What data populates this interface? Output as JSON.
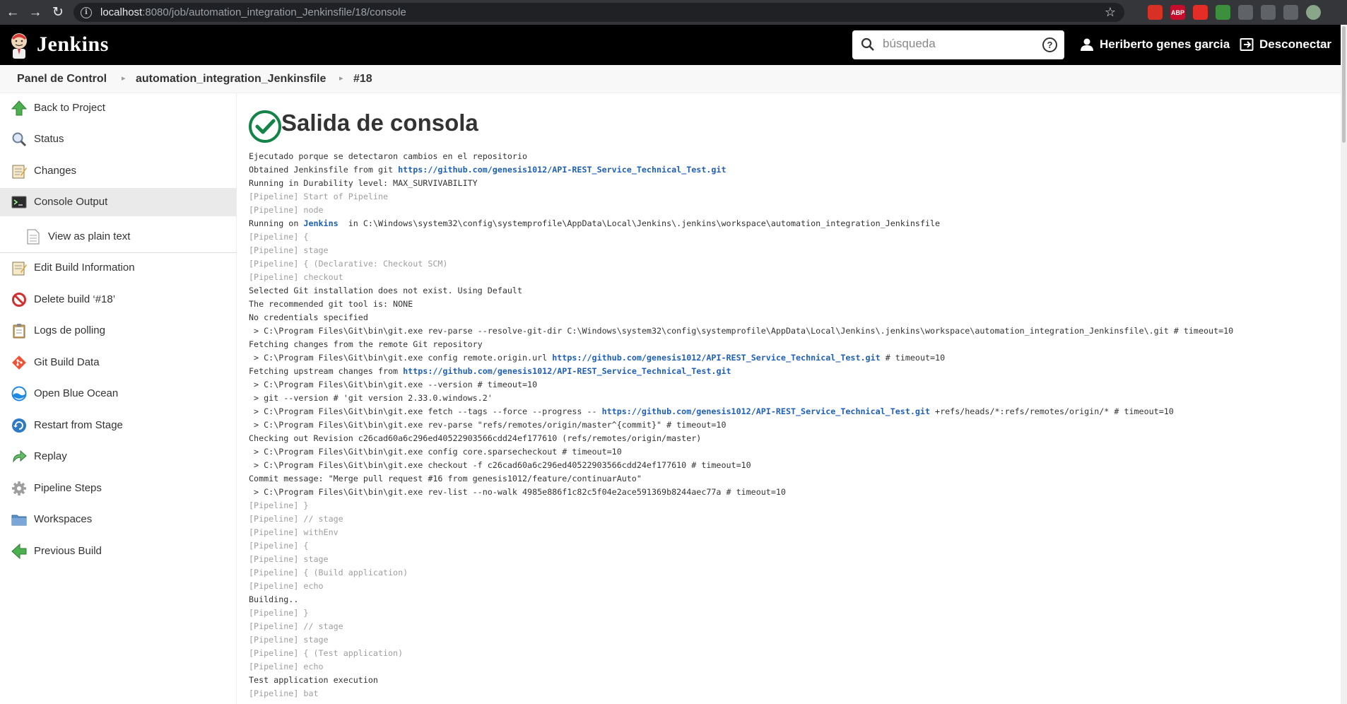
{
  "browser": {
    "url_host": "localhost",
    "url_rest": ":8080/job/automation_integration_Jenkinsfile/18/console",
    "extensions": [
      {
        "name": "ext-red",
        "label": "",
        "color": "#d93025"
      },
      {
        "name": "ext-abp",
        "label": "ABP",
        "color": "#c70d2c"
      },
      {
        "name": "ext-video",
        "label": "",
        "color": "#e52d27"
      },
      {
        "name": "ext-green",
        "label": "",
        "color": "#3c8f3c"
      },
      {
        "name": "ext-doc",
        "label": "",
        "color": "#5f6368"
      },
      {
        "name": "ext-puzzle",
        "label": "",
        "color": "#5f6368"
      },
      {
        "name": "ext-list",
        "label": "",
        "color": "#5f6368"
      },
      {
        "name": "ext-profile",
        "label": "",
        "color": "#8aa68a"
      }
    ]
  },
  "header": {
    "brand": "Jenkins",
    "search_placeholder": "búsqueda",
    "user_name": "Heriberto genes garcia",
    "logout_label": "Desconectar"
  },
  "breadcrumb": {
    "items": [
      "Panel de Control",
      "automation_integration_Jenkinsfile",
      "#18"
    ]
  },
  "sidebar": {
    "items": [
      {
        "label": "Back to Project",
        "icon": "up-arrow-icon"
      },
      {
        "label": "Status",
        "icon": "magnifier-icon"
      },
      {
        "label": "Changes",
        "icon": "notepad-icon"
      },
      {
        "label": "Console Output",
        "icon": "terminal-icon"
      },
      {
        "label": "View as plain text",
        "icon": "document-icon"
      },
      {
        "label": "Edit Build Information",
        "icon": "notepad-icon"
      },
      {
        "label": "Delete build ‘#18’",
        "icon": "no-entry-icon"
      },
      {
        "label": "Logs de polling",
        "icon": "clipboard-icon"
      },
      {
        "label": "Git Build Data",
        "icon": "git-icon"
      },
      {
        "label": "Open Blue Ocean",
        "icon": "blue-ocean-icon"
      },
      {
        "label": "Restart from Stage",
        "icon": "restart-icon"
      },
      {
        "label": "Replay",
        "icon": "replay-icon"
      },
      {
        "label": "Pipeline Steps",
        "icon": "gear-icon"
      },
      {
        "label": "Workspaces",
        "icon": "folder-icon"
      },
      {
        "label": "Previous Build",
        "icon": "left-arrow-icon"
      }
    ]
  },
  "main": {
    "title": "Salida de consola",
    "status": "success",
    "console_lines": [
      {
        "t": "Ejecutado porque se detectaron cambios en el repositorio"
      },
      {
        "t": "Obtained Jenkinsfile from git ",
        "link": "https://github.com/genesis1012/API-REST_Service_Technical_Test.git"
      },
      {
        "t": "Running in Durability level: MAX_SURVIVABILITY"
      },
      {
        "t": "[Pipeline] Start of Pipeline",
        "gray": true
      },
      {
        "t": "[Pipeline] node",
        "gray": true
      },
      {
        "t": "Running on ",
        "link": "Jenkins",
        "after": "  in C:\\Windows\\system32\\config\\systemprofile\\AppData\\Local\\Jenkins\\.jenkins\\workspace\\automation_integration_Jenkinsfile"
      },
      {
        "t": "[Pipeline] {",
        "gray": true
      },
      {
        "t": "[Pipeline] stage",
        "gray": true
      },
      {
        "t": "[Pipeline] { (Declarative: Checkout SCM)",
        "gray": true
      },
      {
        "t": "[Pipeline] checkout",
        "gray": true
      },
      {
        "t": "Selected Git installation does not exist. Using Default"
      },
      {
        "t": "The recommended git tool is: NONE"
      },
      {
        "t": "No credentials specified"
      },
      {
        "t": " > C:\\Program Files\\Git\\bin\\git.exe rev-parse --resolve-git-dir C:\\Windows\\system32\\config\\systemprofile\\AppData\\Local\\Jenkins\\.jenkins\\workspace\\automation_integration_Jenkinsfile\\.git # timeout=10"
      },
      {
        "t": "Fetching changes from the remote Git repository"
      },
      {
        "t": " > C:\\Program Files\\Git\\bin\\git.exe config remote.origin.url ",
        "link": "https://github.com/genesis1012/API-REST_Service_Technical_Test.git",
        "after": " # timeout=10"
      },
      {
        "t": "Fetching upstream changes from ",
        "link": "https://github.com/genesis1012/API-REST_Service_Technical_Test.git"
      },
      {
        "t": " > C:\\Program Files\\Git\\bin\\git.exe --version # timeout=10"
      },
      {
        "t": " > git --version # 'git version 2.33.0.windows.2'"
      },
      {
        "t": " > C:\\Program Files\\Git\\bin\\git.exe fetch --tags --force --progress -- ",
        "link": "https://github.com/genesis1012/API-REST_Service_Technical_Test.git",
        "after": " +refs/heads/*:refs/remotes/origin/* # timeout=10"
      },
      {
        "t": " > C:\\Program Files\\Git\\bin\\git.exe rev-parse \"refs/remotes/origin/master^{commit}\" # timeout=10"
      },
      {
        "t": "Checking out Revision c26cad60a6c296ed40522903566cdd24ef177610 (refs/remotes/origin/master)"
      },
      {
        "t": " > C:\\Program Files\\Git\\bin\\git.exe config core.sparsecheckout # timeout=10"
      },
      {
        "t": " > C:\\Program Files\\Git\\bin\\git.exe checkout -f c26cad60a6c296ed40522903566cdd24ef177610 # timeout=10"
      },
      {
        "t": "Commit message: \"Merge pull request #16 from genesis1012/feature/continuarAuto\""
      },
      {
        "t": " > C:\\Program Files\\Git\\bin\\git.exe rev-list --no-walk 4985e886f1c82c5f04e2ace591369b8244aec77a # timeout=10"
      },
      {
        "t": "[Pipeline] }",
        "gray": true
      },
      {
        "t": "[Pipeline] // stage",
        "gray": true
      },
      {
        "t": "[Pipeline] withEnv",
        "gray": true
      },
      {
        "t": "[Pipeline] {",
        "gray": true
      },
      {
        "t": "[Pipeline] stage",
        "gray": true
      },
      {
        "t": "[Pipeline] { (Build application)",
        "gray": true
      },
      {
        "t": "[Pipeline] echo",
        "gray": true
      },
      {
        "t": "Building.."
      },
      {
        "t": "[Pipeline] }",
        "gray": true
      },
      {
        "t": "[Pipeline] // stage",
        "gray": true
      },
      {
        "t": "[Pipeline] stage",
        "gray": true
      },
      {
        "t": "[Pipeline] { (Test application)",
        "gray": true
      },
      {
        "t": "[Pipeline] echo",
        "gray": true
      },
      {
        "t": "Test application execution"
      },
      {
        "t": "[Pipeline] bat",
        "gray": true
      }
    ]
  },
  "colors": {
    "link": "#1f5fb8",
    "success": "#138347",
    "pipeline_gray": "#9e9e9e"
  }
}
